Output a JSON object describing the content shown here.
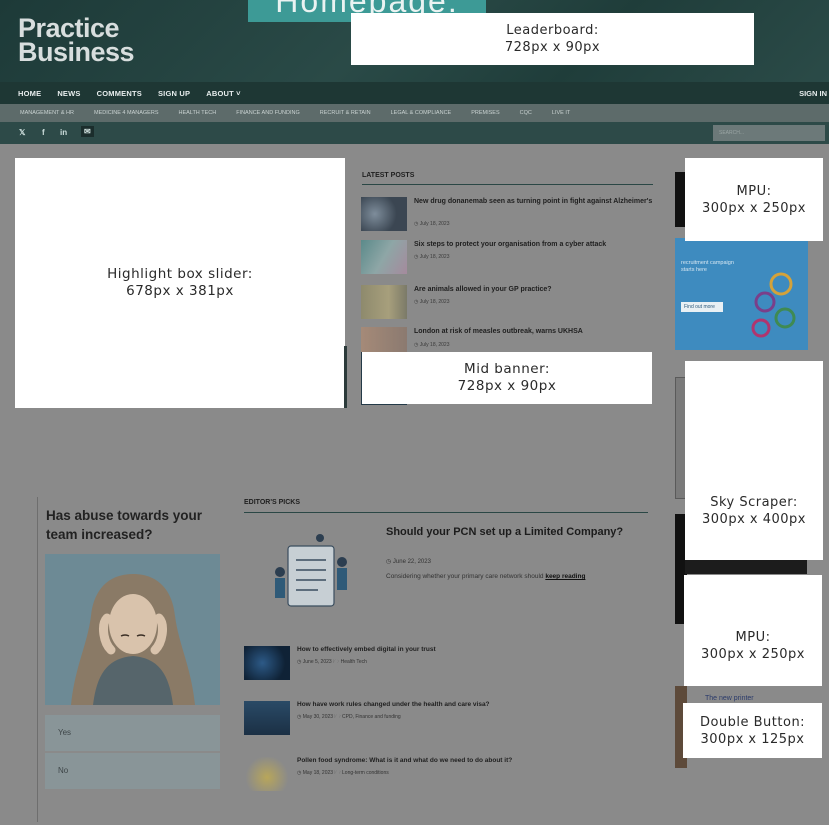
{
  "page_tag": "Homepage:",
  "logo": {
    "line1": "Practice",
    "line2": "Business"
  },
  "ads": {
    "leaderboard": {
      "name": "Leaderboard:",
      "size": "728px x 90px"
    },
    "highlight": {
      "name": "Highlight box slider:",
      "size": "678px x 381px"
    },
    "mid_banner": {
      "name": "Mid banner:",
      "size": "728px x 90px"
    },
    "mpu_top": {
      "name": "MPU:",
      "size": "300px x 250px"
    },
    "sky": {
      "name": "Sky Scraper:",
      "size": "300px x 400px"
    },
    "mpu_bottom": {
      "name": "MPU:",
      "size": "300px x 250px"
    },
    "double": {
      "name": "Double Button:",
      "size": "300px x 125px"
    }
  },
  "nav_main": {
    "items": [
      "HOME",
      "NEWS",
      "COMMENTS",
      "SIGN UP",
      "ABOUT ˅"
    ],
    "signin": "SIGN IN"
  },
  "nav_sub": {
    "items": [
      "MANAGEMENT & HR",
      "MEDICINE 4 MANAGERS",
      "HEALTH TECH",
      "FINANCE AND FUNDING",
      "RECRUIT & RETAIN",
      "LEGAL & COMPLIANCE",
      "PREMISES",
      "CQC",
      "LIVE IT"
    ]
  },
  "social": {
    "twitter": "𝕏",
    "facebook": "f",
    "linkedin": "in",
    "email": "✉"
  },
  "search": {
    "placeholder": "SEARCH..."
  },
  "latest": {
    "title": "LATEST POSTS",
    "posts": [
      {
        "title": "New drug donanemab seen as turning point in fight against Alzheimer's",
        "date": "◷ July 18, 2023"
      },
      {
        "title": "Six steps to protect your organisation from a cyber attack",
        "date": "◷ July 18, 2023"
      },
      {
        "title": "Are animals allowed in your GP practice?",
        "date": "◷ July 18, 2023"
      },
      {
        "title": "London at risk of measles outbreak, warns UKHSA",
        "date": "◷ July 18, 2023"
      }
    ]
  },
  "poll": {
    "question": "Has abuse towards your team increased?",
    "options": [
      "Yes",
      "No"
    ]
  },
  "editors": {
    "title": "EDITOR'S PICKS",
    "main": {
      "title": "Should your PCN set up a Limited Company?",
      "date": "◷ June 22, 2023",
      "excerpt": "Considering whether your primary care network should ",
      "link": "keep reading"
    },
    "picks": [
      {
        "title": "How to effectively embed digital in your trust",
        "meta": "◷ June 5, 2023   🗁 Health Tech"
      },
      {
        "title": "How have work rules changed under the health and care visa?",
        "meta": "◷ May 30, 2023   🗁 CPD, Finance and funding"
      },
      {
        "title": "Pollen food syndrome: What is it and what do we need to do about it?",
        "meta": "◷ May 18, 2023   🗁 Long-term conditions"
      }
    ]
  },
  "side": {
    "recruit_text": "recruitment campaign starts here",
    "recruit_button": "Find out more",
    "printer_text": "The new printer"
  },
  "colors": {
    "accent": "#3d9a96",
    "header": "#22403e",
    "nav": "#1e3734"
  }
}
